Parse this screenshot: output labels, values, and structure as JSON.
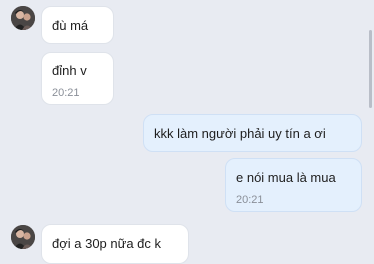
{
  "messages": [
    {
      "direction": "incoming",
      "text": "đù má"
    },
    {
      "direction": "incoming",
      "text": "đỉnh v",
      "time": "20:21"
    },
    {
      "direction": "outgoing",
      "text": "kkk làm người phải uy tín a ơi"
    },
    {
      "direction": "outgoing",
      "text": "e nói mua là mua",
      "time": "20:21"
    },
    {
      "direction": "incoming",
      "text": "đợi a 30p nữa đc k"
    }
  ],
  "colors": {
    "background": "#e8ebf2",
    "incoming_bubble": "#ffffff",
    "outgoing_bubble": "#e4f0fd",
    "timestamp": "#8a8f98"
  },
  "icons": {
    "avatar": "contact-avatar-icon"
  }
}
